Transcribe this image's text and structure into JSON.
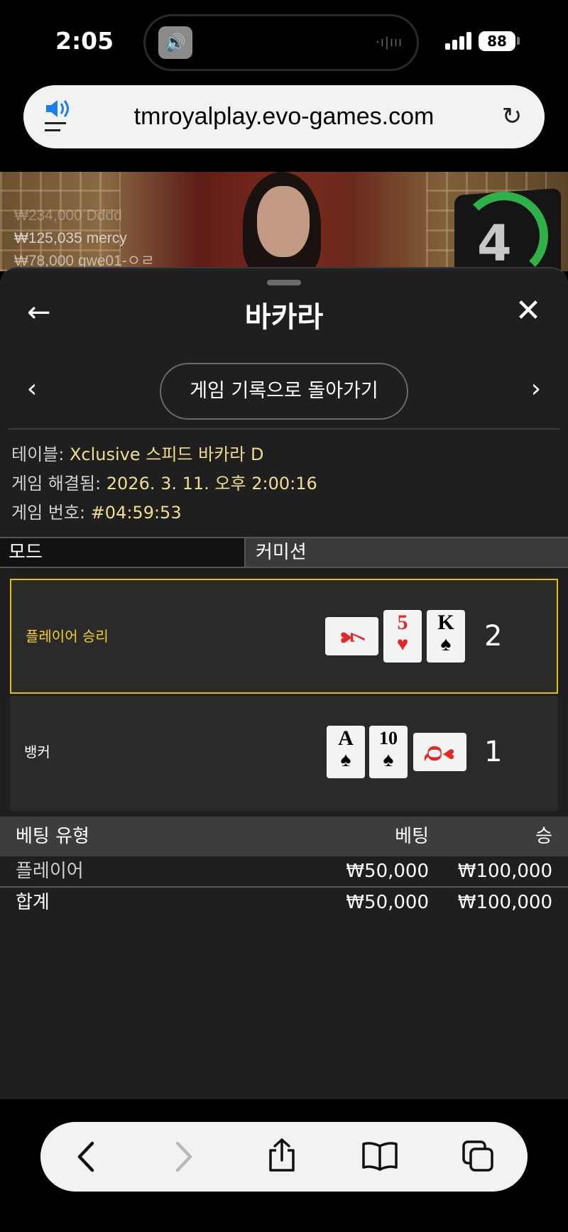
{
  "status": {
    "time": "2:05",
    "battery": "88"
  },
  "browser": {
    "url": "tmroyalplay.evo-games.com"
  },
  "video": {
    "winners": [
      {
        "amount": "₩234,000",
        "name": "Dddd"
      },
      {
        "amount": "₩125,035",
        "name": "mercy"
      },
      {
        "amount": "₩78,000",
        "name": "qwe01-ㅇㄹ"
      }
    ],
    "timer": "4"
  },
  "sheet": {
    "title": "바카라",
    "history_button": "게임 기록으로 돌아가기",
    "info": {
      "table_label": "테이블:",
      "table_value": "Xclusive 스피드 바카라 D",
      "resolved_label": "게임 해결됨:",
      "resolved_value": "2026. 3. 11. 오후 2:00:16",
      "number_label": "게임 번호:",
      "number_value": "#04:59:53"
    },
    "tabs": {
      "mode": "모드",
      "commission": "커미션"
    },
    "player": {
      "label": "플레이어 승리",
      "cards": [
        {
          "rank": "7",
          "suit": "♥"
        },
        {
          "rank": "5",
          "suit": "♥"
        },
        {
          "rank": "K",
          "suit": "♠"
        }
      ],
      "score": "2"
    },
    "banker": {
      "label": "뱅커",
      "cards": [
        {
          "rank": "A",
          "suit": "♠"
        },
        {
          "rank": "10",
          "suit": "♠"
        },
        {
          "rank": "Q",
          "suit": "♥"
        }
      ],
      "score": "1"
    },
    "bets": {
      "headers": {
        "type": "베팅 유형",
        "bet": "베팅",
        "win": "승"
      },
      "rows": [
        {
          "type": "플레이어",
          "bet": "₩50,000",
          "win": "₩100,000"
        }
      ],
      "total": {
        "type": "합계",
        "bet": "₩50,000",
        "win": "₩100,000"
      }
    }
  },
  "colors": {
    "accent": "#f2d21a",
    "value_text": "#f3dc8e",
    "timer_green": "#2fb04a",
    "card_red": "#e02a2a"
  }
}
